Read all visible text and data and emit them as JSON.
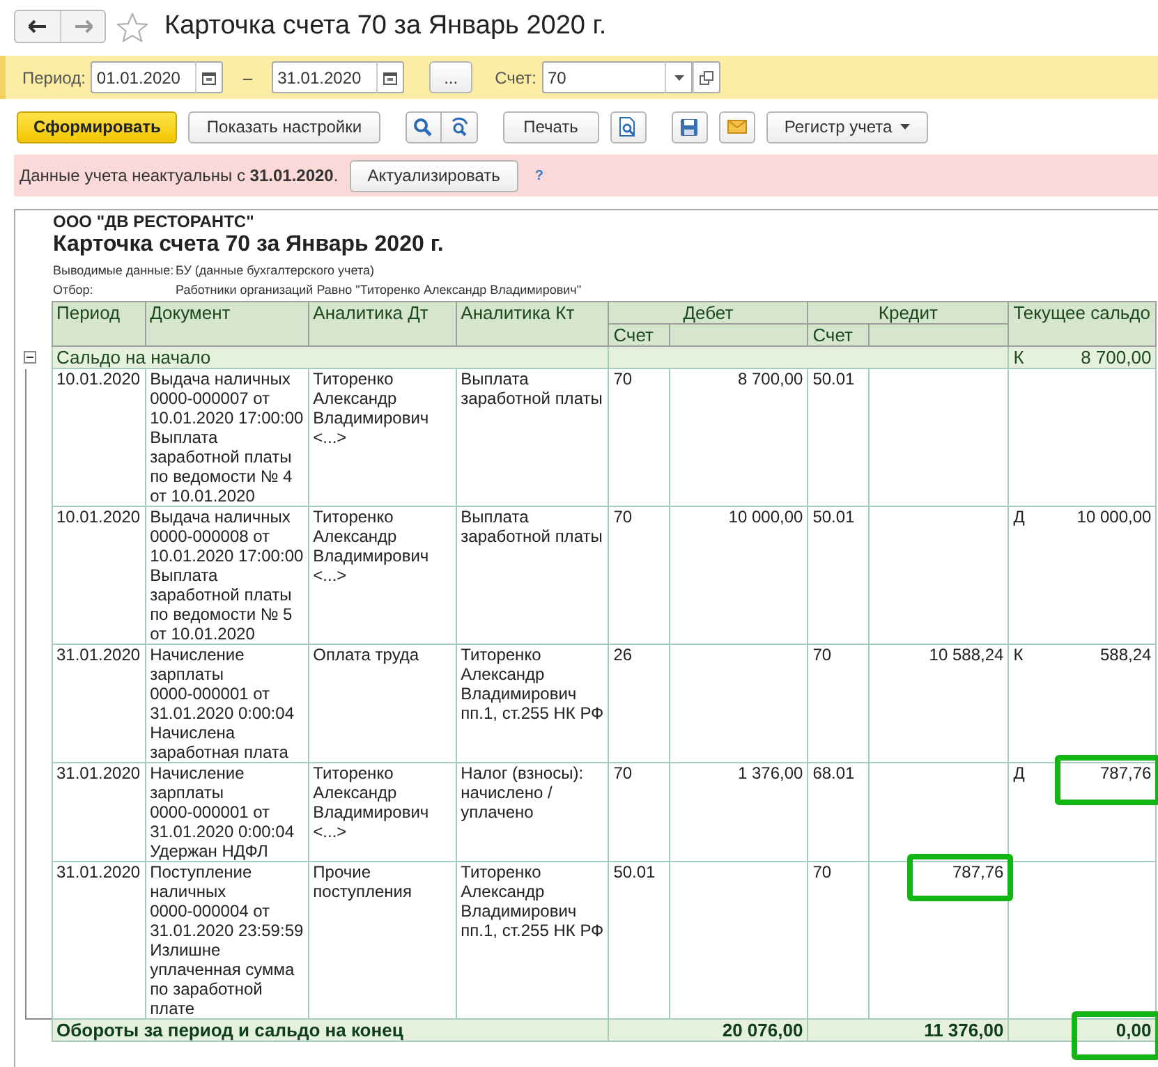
{
  "window": {
    "title": "Карточка счета 70 за Январь 2020 г.",
    "favorite": false
  },
  "filters": {
    "period_label": "Период:",
    "date_from": "01.01.2020",
    "separator": "–",
    "date_to": "31.01.2020",
    "more_button": "...",
    "account_label": "Счет:",
    "account": "70"
  },
  "toolbar": {
    "generate_button": "Сформировать",
    "settings_button": "Показать настройки",
    "print_button": "Печать",
    "register_button": "Регистр учета"
  },
  "warning": {
    "text": "Данные учета неактуальны с **31.01.2020**.",
    "button": "Актуализировать",
    "help": "?"
  },
  "report": {
    "organization": "ООО \"ДВ РЕСТОРАНТС\"",
    "title": "Карточка счета 70 за Январь 2020 г.",
    "params": [
      {
        "label": "Выводимые данные:",
        "value": "БУ (данные бухгалтерского учета)"
      },
      {
        "label": "Отбор:",
        "value": "Работники организаций Равно \"Титоренко Александр Владимирович\""
      }
    ],
    "columns": {
      "period": "Период",
      "document": "Документ",
      "analytics_dt": "Аналитика Дт",
      "analytics_kt": "Аналитика Кт",
      "debit": "Дебет",
      "debit_account": "Счет",
      "credit": "Кредит",
      "credit_account": "Счет",
      "balance": "Текущее сальдо"
    },
    "opening": {
      "label": "Сальдо на начало",
      "side": "К",
      "amount": "8 700,00",
      "expanded": true
    },
    "rows": [
      {
        "period": "10.01.2020",
        "document": "Выдача наличных\n0000-000007 от\n10.01.2020 17:00:00\nВыплата\nзаработной платы\nпо ведомости № 4\nот 10.01.2020",
        "analytics_dt": "Титоренко\nАлександр\nВладимирович\n<...>",
        "analytics_kt": "Выплата\nзаработной платы",
        "debit_account": "70",
        "debit_amount": "8 700,00",
        "credit_account": "50.01",
        "credit_amount": "",
        "balance_side": "",
        "balance_amount": "",
        "marked_credit": false,
        "marked_balance": false
      },
      {
        "period": "10.01.2020",
        "document": "Выдача наличных\n0000-000008 от\n10.01.2020 17:00:00\nВыплата\nзаработной платы\nпо ведомости № 5\nот 10.01.2020",
        "analytics_dt": "Титоренко\nАлександр\nВладимирович\n<...>",
        "analytics_kt": "Выплата\nзаработной платы",
        "debit_account": "70",
        "debit_amount": "10 000,00",
        "credit_account": "50.01",
        "credit_amount": "",
        "balance_side": "Д",
        "balance_amount": "10 000,00",
        "marked_credit": false,
        "marked_balance": false
      },
      {
        "period": "31.01.2020",
        "document": "Начисление\nзарплаты\n0000-000001 от\n31.01.2020 0:00:04\nНачислена\nзаработная плата",
        "analytics_dt": "Оплата труда",
        "analytics_kt": "Титоренко\nАлександр\nВладимирович\nпп.1, ст.255 НК РФ",
        "debit_account": "26",
        "debit_amount": "",
        "credit_account": "70",
        "credit_amount": "10 588,24",
        "balance_side": "К",
        "balance_amount": "588,24",
        "marked_credit": false,
        "marked_balance": false
      },
      {
        "period": "31.01.2020",
        "document": "Начисление\nзарплаты\n0000-000001 от\n31.01.2020 0:00:04\nУдержан НДФЛ",
        "analytics_dt": "Титоренко\nАлександр\nВладимирович\n<...>",
        "analytics_kt": "Налог (взносы):\nначислено /\nуплачено",
        "debit_account": "70",
        "debit_amount": "1 376,00",
        "credit_account": "68.01",
        "credit_amount": "",
        "balance_side": "Д",
        "balance_amount": "787,76",
        "marked_credit": false,
        "marked_balance": true
      },
      {
        "period": "31.01.2020",
        "document": "Поступление\nналичных\n0000-000004 от\n31.01.2020 23:59:59\nИзлишне\nуплаченная сумма\nпо заработной\nплате",
        "analytics_dt": "Прочие\nпоступления",
        "analytics_kt": "Титоренко\nАлександр\nВладимирович\nпп.1, ст.255 НК РФ",
        "debit_account": "50.01",
        "debit_amount": "",
        "credit_account": "70",
        "credit_amount": "787,76",
        "balance_side": "",
        "balance_amount": "",
        "marked_credit": true,
        "marked_balance": false
      }
    ],
    "totals": {
      "label": "Обороты за период и сальдо на конец",
      "debit": "20 076,00",
      "credit": "11 376,00",
      "balance": "0,00",
      "marked_balance": true
    }
  }
}
